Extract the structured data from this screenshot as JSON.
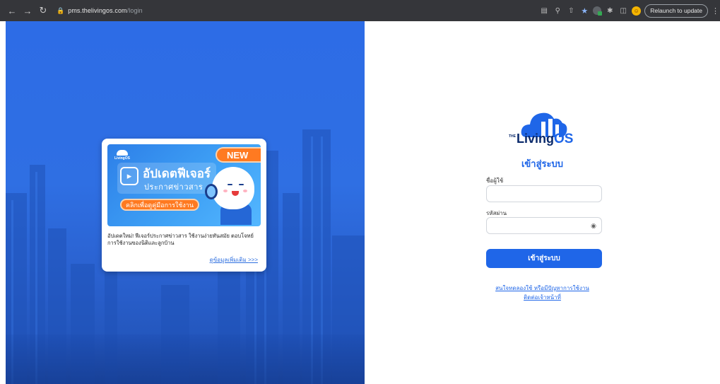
{
  "browser": {
    "url_host": "pms.thelivingos.com",
    "url_path": "/login",
    "relaunch_label": "Relaunch to update"
  },
  "promo": {
    "banner_new": "NEW",
    "banner_title": "อัปเดตฟีเจอร์",
    "banner_subtitle": "ประกาศข่าวสาร",
    "banner_button": "คลิกเพื่อดูคู่มือการใช้งาน",
    "banner_logo": "LivingOS",
    "description": "อัปเดตใหม่! ฟีเจอร์ประกาศข่าวสาร ใช้งานง่ายทันสมัย ตอบโจทย์การใช้งานของนิติและลูกบ้าน",
    "more_link": "ดูข้อมูลเพิ่มเติม >>>"
  },
  "login": {
    "logo_the": "THE",
    "logo_living": "Living",
    "logo_os": "OS",
    "title": "เข้าสู่ระบบ",
    "username_label": "ชื่อผู้ใช้",
    "username_value": "",
    "password_label": "รหัสผ่าน",
    "password_value": "",
    "submit_label": "เข้าสู่ระบบ",
    "help_line1": "สนใจทดลองใช้ หรือมีปัญหาการใช้งาน",
    "help_line2": "ติดต่อเจ้าหน้าที่"
  },
  "colors": {
    "brand_blue": "#1f66e8",
    "brand_navy": "#0b2a6b",
    "promo_orange": "#ff7a21"
  }
}
